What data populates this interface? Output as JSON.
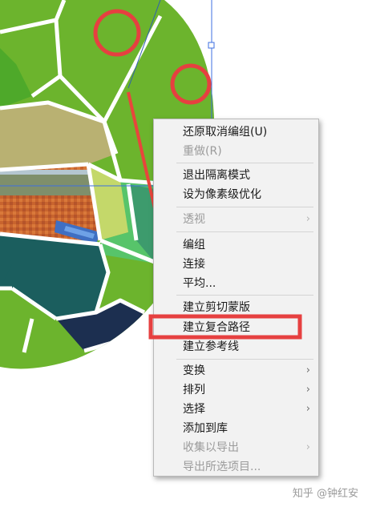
{
  "colors": {
    "menu_background": "#f2f2f2",
    "highlight_red": "#e64040",
    "arrow_red": "#e8453c",
    "leaf_green": "#6cb42d"
  },
  "canvas": {
    "anchor_icon": "anchor-point-icon",
    "annotations": [
      "red-circle-highlight",
      "red-circle-highlight",
      "red-arrow",
      "red-rectangle-highlight"
    ]
  },
  "context_menu": {
    "items": [
      {
        "label": "还原取消编组(U)",
        "enabled": true,
        "submenu": false
      },
      {
        "label": "重做(R)",
        "enabled": false,
        "submenu": false
      },
      {
        "label": "退出隔离模式",
        "enabled": true,
        "submenu": false
      },
      {
        "label": "设为像素级优化",
        "enabled": true,
        "submenu": false
      },
      {
        "label": "透视",
        "enabled": false,
        "submenu": true
      },
      {
        "label": "编组",
        "enabled": true,
        "submenu": false
      },
      {
        "label": "连接",
        "enabled": true,
        "submenu": false
      },
      {
        "label": "平均...",
        "enabled": true,
        "submenu": false
      },
      {
        "label": "建立剪切蒙版",
        "enabled": true,
        "submenu": false
      },
      {
        "label": "建立复合路径",
        "enabled": true,
        "submenu": false
      },
      {
        "label": "建立参考线",
        "enabled": true,
        "submenu": false
      },
      {
        "label": "变换",
        "enabled": true,
        "submenu": true
      },
      {
        "label": "排列",
        "enabled": true,
        "submenu": true
      },
      {
        "label": "选择",
        "enabled": true,
        "submenu": true
      },
      {
        "label": "添加到库",
        "enabled": true,
        "submenu": false
      },
      {
        "label": "收集以导出",
        "enabled": false,
        "submenu": true
      },
      {
        "label": "导出所选项目...",
        "enabled": false,
        "submenu": false
      }
    ],
    "submenu_arrow": "›"
  },
  "watermark": "知乎 @钟红安"
}
